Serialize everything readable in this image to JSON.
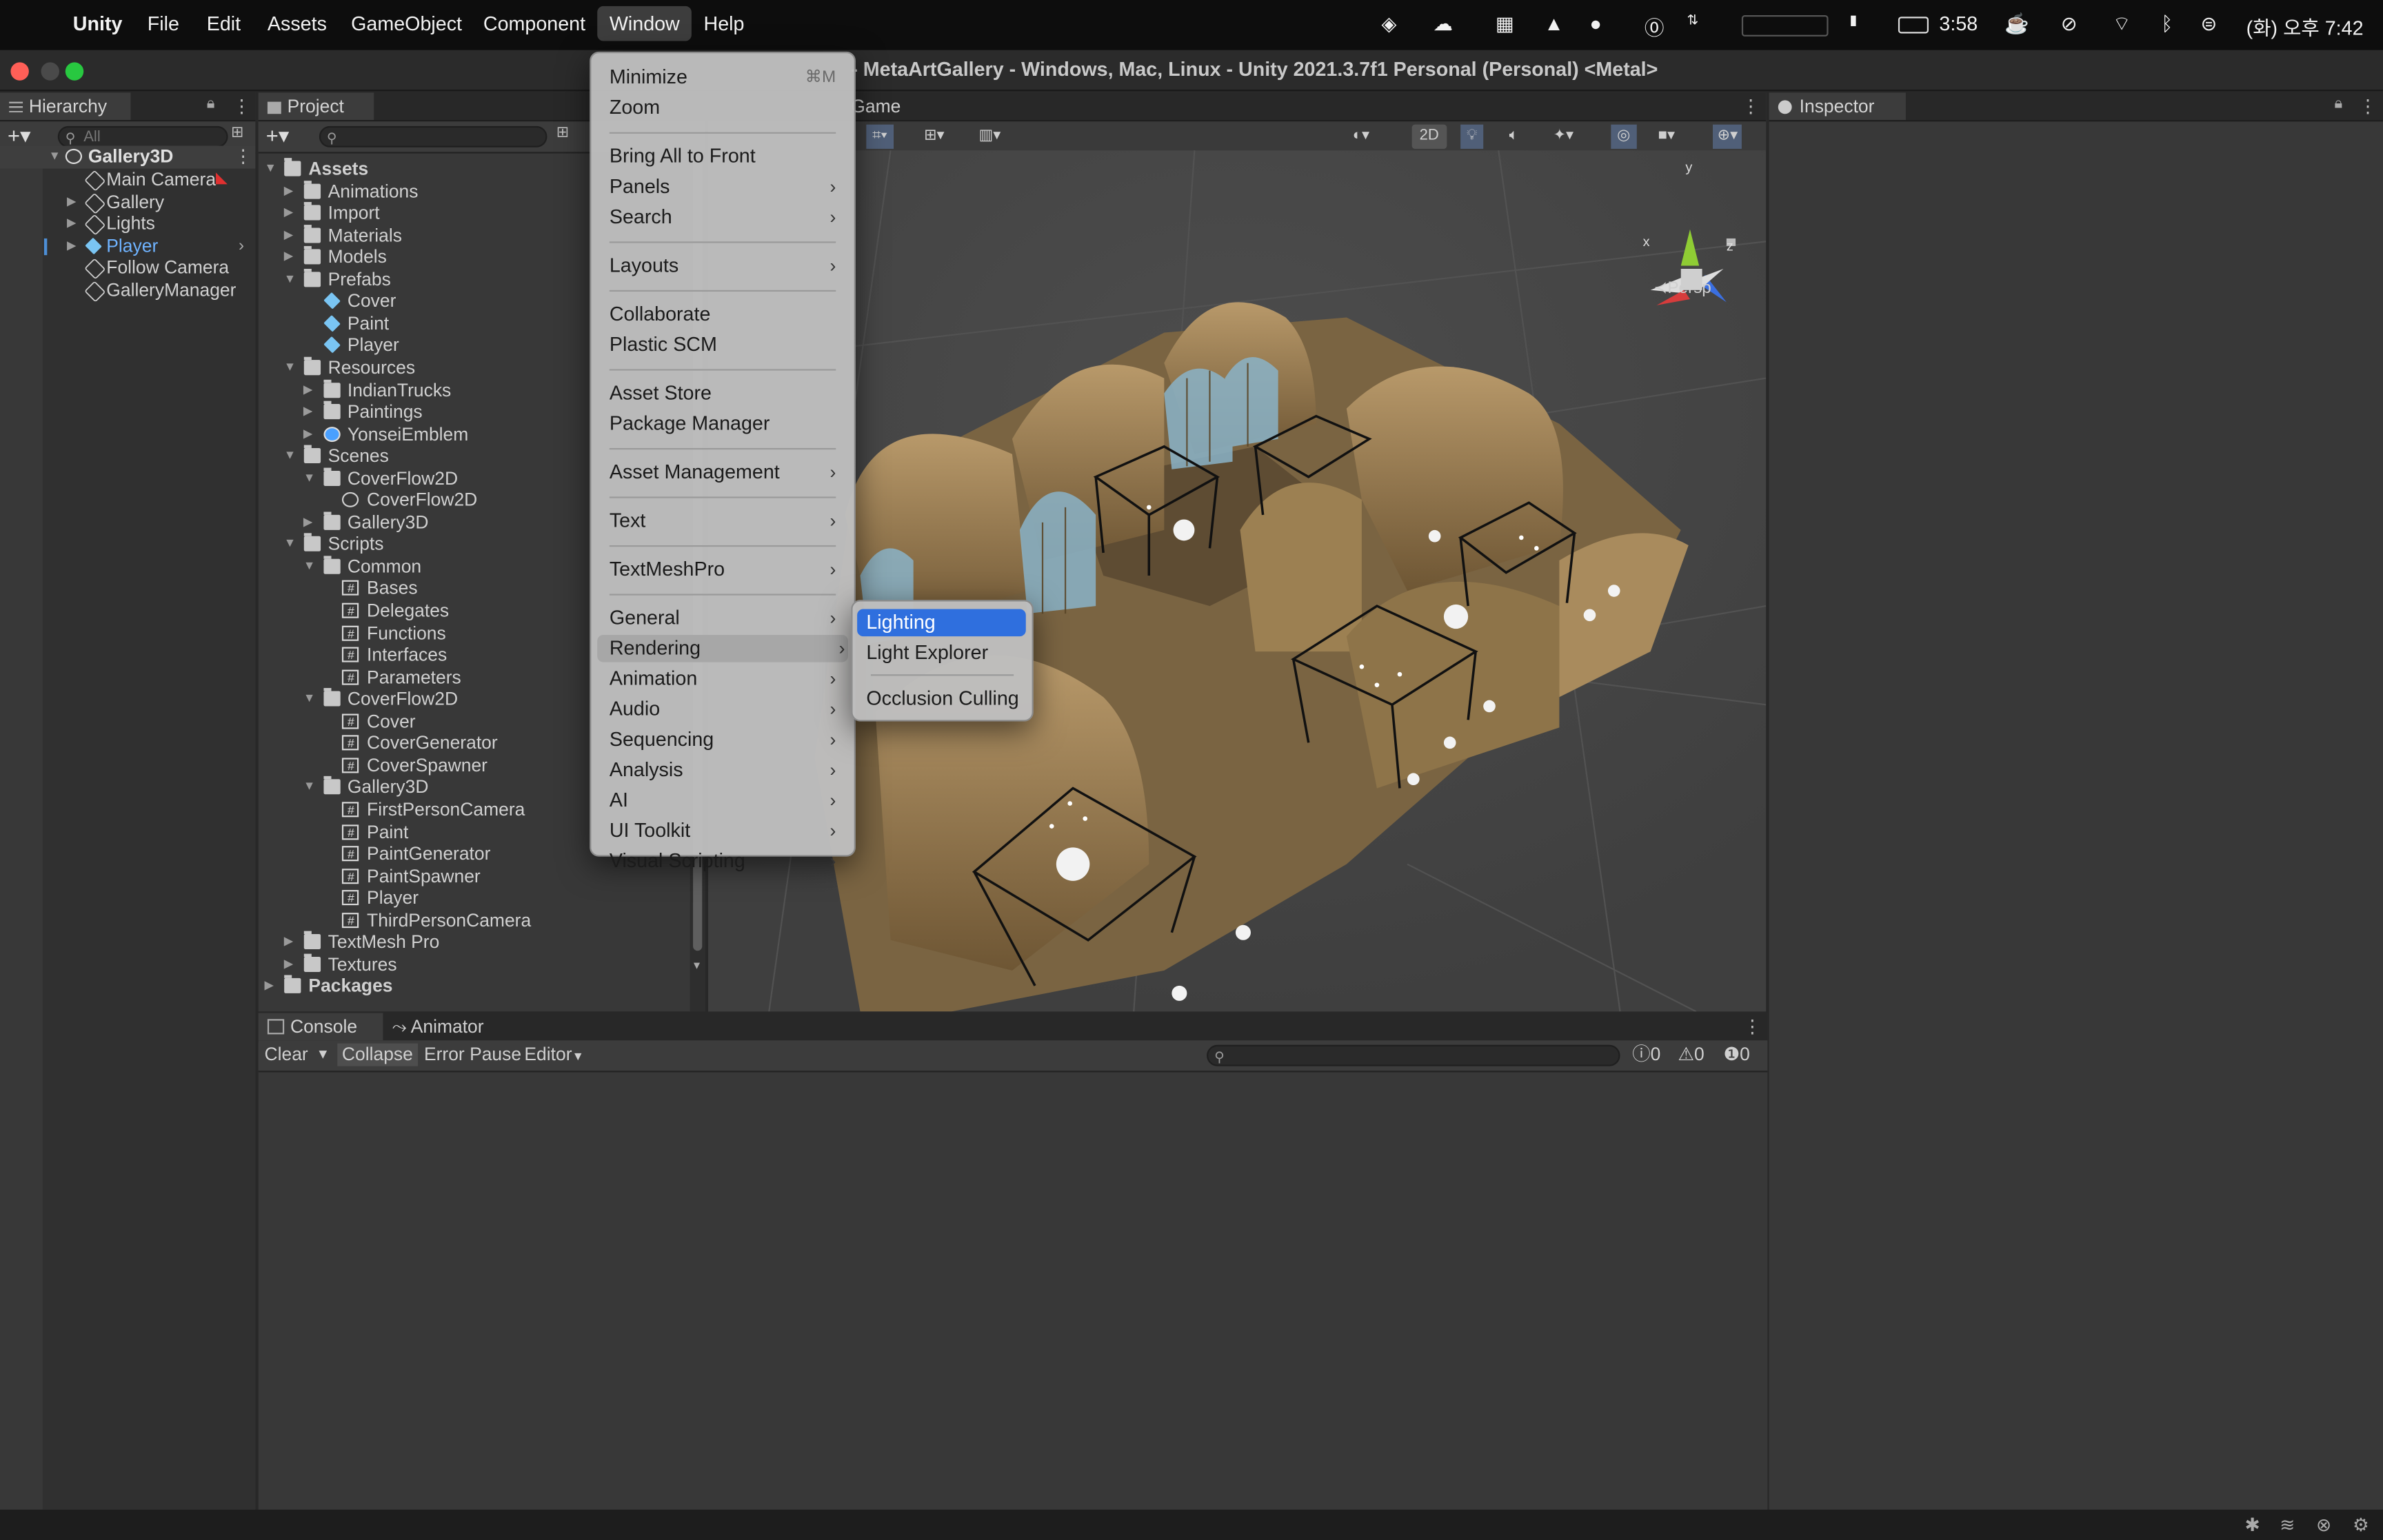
{
  "menubar": {
    "app": "Unity",
    "items": [
      "File",
      "Edit",
      "Assets",
      "GameObject",
      "Component",
      "Window",
      "Help"
    ],
    "battery_time": "3:58",
    "clock": "(화) 오후 7:42"
  },
  "window": {
    "title": "- MetaArtGallery - Windows, Mac, Linux - Unity 2021.3.7f1 Personal (Personal) <Metal>"
  },
  "hierarchy": {
    "tab": "Hierarchy",
    "search_placeholder": "All",
    "scene": "Gallery3D",
    "items": [
      "Main Camera",
      "Gallery",
      "Lights",
      "Player",
      "Follow Camera",
      "GalleryManager"
    ]
  },
  "project": {
    "tab": "Project",
    "tree": [
      {
        "label": "Assets",
        "level": 0,
        "icon": "folder",
        "open": true
      },
      {
        "label": "Animations",
        "level": 1,
        "icon": "folder",
        "arrow": "closed"
      },
      {
        "label": "Import",
        "level": 1,
        "icon": "folder",
        "arrow": "closed"
      },
      {
        "label": "Materials",
        "level": 1,
        "icon": "folder",
        "arrow": "closed"
      },
      {
        "label": "Models",
        "level": 1,
        "icon": "folder",
        "arrow": "closed"
      },
      {
        "label": "Prefabs",
        "level": 1,
        "icon": "folder",
        "arrow": "open"
      },
      {
        "label": "Cover",
        "level": 2,
        "icon": "prefab"
      },
      {
        "label": "Paint",
        "level": 2,
        "icon": "prefab"
      },
      {
        "label": "Player",
        "level": 2,
        "icon": "prefab"
      },
      {
        "label": "Resources",
        "level": 1,
        "icon": "folder",
        "arrow": "open"
      },
      {
        "label": "IndianTrucks",
        "level": 2,
        "icon": "folder",
        "arrow": "closed"
      },
      {
        "label": "Paintings",
        "level": 2,
        "icon": "folder",
        "arrow": "closed"
      },
      {
        "label": "YonseiEmblem",
        "level": 2,
        "icon": "bundle",
        "arrow": "closed"
      },
      {
        "label": "Scenes",
        "level": 1,
        "icon": "folder",
        "arrow": "open"
      },
      {
        "label": "CoverFlow2D",
        "level": 2,
        "icon": "folder",
        "arrow": "open"
      },
      {
        "label": "CoverFlow2D",
        "level": 3,
        "icon": "scene"
      },
      {
        "label": "Gallery3D",
        "level": 2,
        "icon": "folder",
        "arrow": "closed"
      },
      {
        "label": "Scripts",
        "level": 1,
        "icon": "folder",
        "arrow": "open"
      },
      {
        "label": "Common",
        "level": 2,
        "icon": "folder",
        "arrow": "open"
      },
      {
        "label": "Bases",
        "level": 3,
        "icon": "script"
      },
      {
        "label": "Delegates",
        "level": 3,
        "icon": "script"
      },
      {
        "label": "Functions",
        "level": 3,
        "icon": "script"
      },
      {
        "label": "Interfaces",
        "level": 3,
        "icon": "script"
      },
      {
        "label": "Parameters",
        "level": 3,
        "icon": "script"
      },
      {
        "label": "CoverFlow2D",
        "level": 2,
        "icon": "folder",
        "arrow": "open"
      },
      {
        "label": "Cover",
        "level": 3,
        "icon": "script"
      },
      {
        "label": "CoverGenerator",
        "level": 3,
        "icon": "script"
      },
      {
        "label": "CoverSpawner",
        "level": 3,
        "icon": "script"
      },
      {
        "label": "Gallery3D",
        "level": 2,
        "icon": "folder",
        "arrow": "open"
      },
      {
        "label": "FirstPersonCamera",
        "level": 3,
        "icon": "script"
      },
      {
        "label": "Paint",
        "level": 3,
        "icon": "script"
      },
      {
        "label": "PaintGenerator",
        "level": 3,
        "icon": "script"
      },
      {
        "label": "PaintSpawner",
        "level": 3,
        "icon": "script"
      },
      {
        "label": "Player",
        "level": 3,
        "icon": "script"
      },
      {
        "label": "ThirdPersonCamera",
        "level": 3,
        "icon": "script"
      },
      {
        "label": "TextMesh Pro",
        "level": 1,
        "icon": "folder",
        "arrow": "closed"
      },
      {
        "label": "Textures",
        "level": 1,
        "icon": "folder",
        "arrow": "closed"
      },
      {
        "label": "Packages",
        "level": 0,
        "icon": "folder",
        "arrow": "closed"
      }
    ]
  },
  "scene_view": {
    "tab": "Game",
    "mode_2d": "2D",
    "persp_label": "Persp",
    "axis": {
      "x": "x",
      "y": "y",
      "z": "z"
    }
  },
  "inspector": {
    "tab": "Inspector"
  },
  "window_menu": {
    "groups": [
      [
        {
          "label": "Minimize",
          "shortcut": "⌘M"
        },
        {
          "label": "Zoom"
        }
      ],
      [
        {
          "label": "Bring All to Front"
        },
        {
          "label": "Panels",
          "submenu": true
        },
        {
          "label": "Search",
          "submenu": true
        }
      ],
      [
        {
          "label": "Layouts",
          "submenu": true
        }
      ],
      [
        {
          "label": "Collaborate"
        },
        {
          "label": "Plastic SCM"
        }
      ],
      [
        {
          "label": "Asset Store"
        },
        {
          "label": "Package Manager"
        }
      ],
      [
        {
          "label": "Asset Management",
          "submenu": true
        }
      ],
      [
        {
          "label": "Text",
          "submenu": true
        }
      ],
      [
        {
          "label": "TextMeshPro",
          "submenu": true
        }
      ],
      [
        {
          "label": "General",
          "submenu": true
        },
        {
          "label": "Rendering",
          "submenu": true,
          "highlighted": true
        },
        {
          "label": "Animation",
          "submenu": true
        },
        {
          "label": "Audio",
          "submenu": true
        },
        {
          "label": "Sequencing",
          "submenu": true
        },
        {
          "label": "Analysis",
          "submenu": true
        },
        {
          "label": "AI",
          "submenu": true
        },
        {
          "label": "UI Toolkit",
          "submenu": true
        },
        {
          "label": "Visual Scripting",
          "submenu": true
        }
      ]
    ]
  },
  "rendering_submenu": {
    "items": [
      {
        "label": "Lighting",
        "selected": true
      },
      {
        "label": "Light Explorer"
      },
      {
        "label": "Occlusion Culling"
      }
    ]
  },
  "console": {
    "tabs": [
      "Console",
      "Animator"
    ],
    "buttons": [
      "Clear",
      "Collapse",
      "Error Pause",
      "Editor"
    ],
    "counts": {
      "log": "0",
      "warning": "0",
      "error": "0"
    }
  },
  "colors": {
    "menu_highlight": "#2f6fde",
    "selected_text": "#6fb3ff",
    "prefab_icon": "#7ac5f3"
  }
}
